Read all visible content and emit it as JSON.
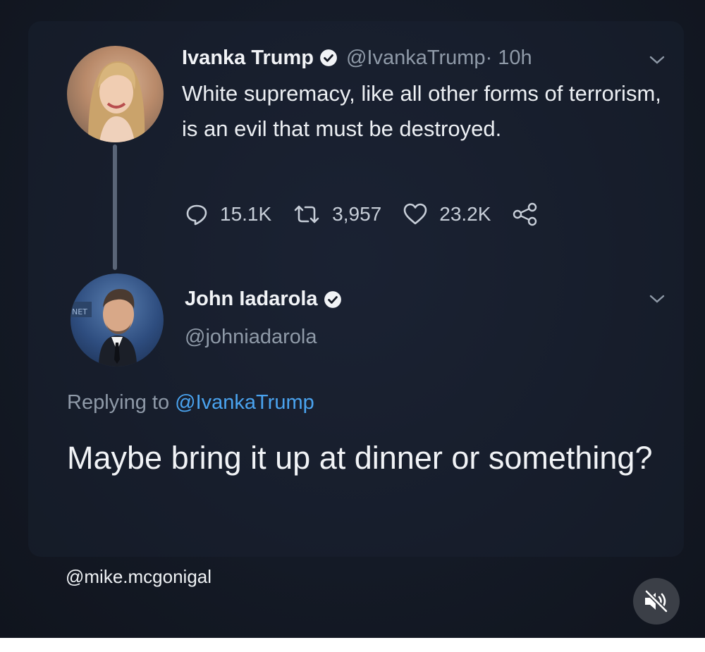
{
  "tweet1": {
    "name": "Ivanka Trump",
    "handle": "@IvankaTrump",
    "time": " · 10h",
    "text": "White supremacy, like all other forms of terrorism, is an evil that must be destroyed.",
    "replies": "15.1K",
    "retweets": "3,957",
    "likes": "23.2K"
  },
  "tweet2": {
    "name": "John Iadarola",
    "handle": "@johniadarola",
    "replying_prefix": "Replying to ",
    "replying_to": "@IvankaTrump",
    "text": "Maybe bring it up at dinner or something?"
  },
  "footer": {
    "credit": "@mike.mcgonigal"
  },
  "colors": {
    "background": "#121722",
    "link": "#4aa3ef",
    "secondary_text": "#8f9aa8"
  }
}
